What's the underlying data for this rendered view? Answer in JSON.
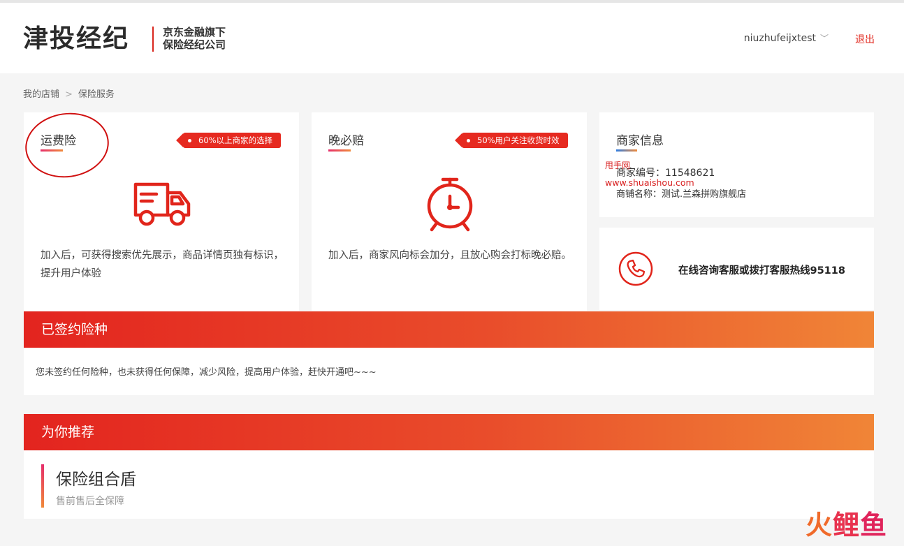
{
  "header": {
    "logo_main": "津投经纪",
    "logo_sub_line1": "京东金融旗下",
    "logo_sub_line2": "保险经纪公司",
    "username": "niuzhufeijxtest",
    "logout_label": "退出"
  },
  "breadcrumb": {
    "item1": "我的店铺",
    "item2": "保险服务"
  },
  "cards": {
    "freight": {
      "title": "运费险",
      "badge": "60%以上商家的选择",
      "description": "加入后，可获得搜索优先展示，商品详情页独有标识，提升用户体验",
      "icon": "delivery-truck-icon"
    },
    "late_pay": {
      "title": "晚必赔",
      "badge": "50%用户关注收货时效",
      "description": "加入后，商家风向标会加分，且放心购会打标晚必赔。",
      "icon": "alarm-clock-icon"
    },
    "merchant": {
      "title": "商家信息",
      "number_label": "商家编号：",
      "number_value": "11548621",
      "shop_label": "商铺名称：",
      "shop_value": "测试.兰森拼购旗舰店"
    },
    "hotline": {
      "text": "在线咨询客服或拨打客服热线95118",
      "icon": "phone-icon"
    }
  },
  "signed": {
    "title": "已签约险种",
    "body": "您未签约任何险种，也未获得任何保障，减少风险，提高用户体验，赶快开通吧~~~"
  },
  "recommend": {
    "title": "为你推荐",
    "item_title": "保险组合盾",
    "item_sub": "售前售后全保障"
  },
  "watermarks": {
    "site_cn": "甩手网",
    "site_url": "www.shuaishou.com",
    "brand_a": "火",
    "brand_b": "鲤",
    "brand_c": "鱼"
  },
  "colors": {
    "accent": "#e1251b",
    "gradient_start": "#e3241f",
    "gradient_end": "#f08537"
  }
}
